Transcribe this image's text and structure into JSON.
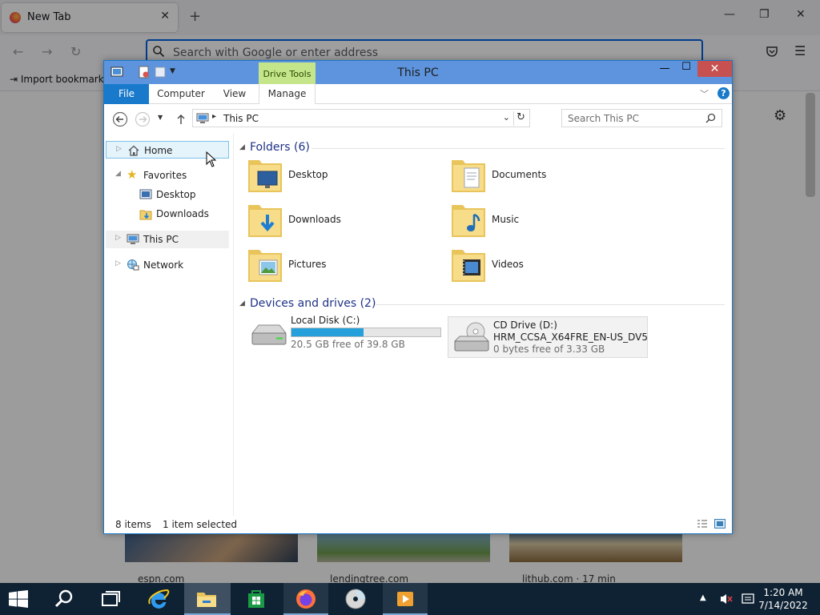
{
  "browser": {
    "tab_title": "New Tab",
    "tab_close": "✕",
    "new_tab": "+",
    "address_placeholder": "Search with Google or enter address",
    "import_bookmarks": "Import bookmarks",
    "tiles": [
      {
        "label": "espn.com"
      },
      {
        "label": "lendingtree.com"
      },
      {
        "label": "lithub.com · 17 min"
      }
    ]
  },
  "explorer": {
    "title": "This PC",
    "contextual_tab": "Drive Tools",
    "ribbon_tabs": [
      "File",
      "Computer",
      "View",
      "Manage"
    ],
    "help": "?",
    "address": {
      "location": "This PC"
    },
    "search_placeholder": "Search This PC",
    "nav": {
      "home": "Home",
      "favorites": "Favorites",
      "desktop": "Desktop",
      "downloads": "Downloads",
      "this_pc": "This PC",
      "network": "Network"
    },
    "folders_header": "Folders (6)",
    "folders": [
      {
        "name": "Desktop",
        "icon": "desktop-folder-icon"
      },
      {
        "name": "Documents",
        "icon": "documents-folder-icon"
      },
      {
        "name": "Downloads",
        "icon": "downloads-folder-icon"
      },
      {
        "name": "Music",
        "icon": "music-folder-icon"
      },
      {
        "name": "Pictures",
        "icon": "pictures-folder-icon"
      },
      {
        "name": "Videos",
        "icon": "videos-folder-icon"
      }
    ],
    "devices_header": "Devices and drives (2)",
    "drives": [
      {
        "name": "Local Disk (C:)",
        "free_text": "20.5 GB free of 39.8 GB",
        "used_fraction": 0.485
      },
      {
        "name": "CD Drive (D:)",
        "volume": "HRM_CCSA_X64FRE_EN-US_DV5",
        "free_text": "0 bytes free of 3.33 GB"
      }
    ],
    "status": {
      "items": "8 items",
      "selected": "1 item selected"
    }
  },
  "taskbar": {
    "clock_time": "1:20 AM",
    "clock_date": "7/14/2022",
    "tray_up": "▲"
  },
  "colors": {
    "titlebar": "#5d94dd",
    "file_tab": "#1979ca",
    "drive_tools": "#c5e58a",
    "close": "#c75050",
    "drive_bar": "#26a0da",
    "taskbar": "#0f2233"
  }
}
